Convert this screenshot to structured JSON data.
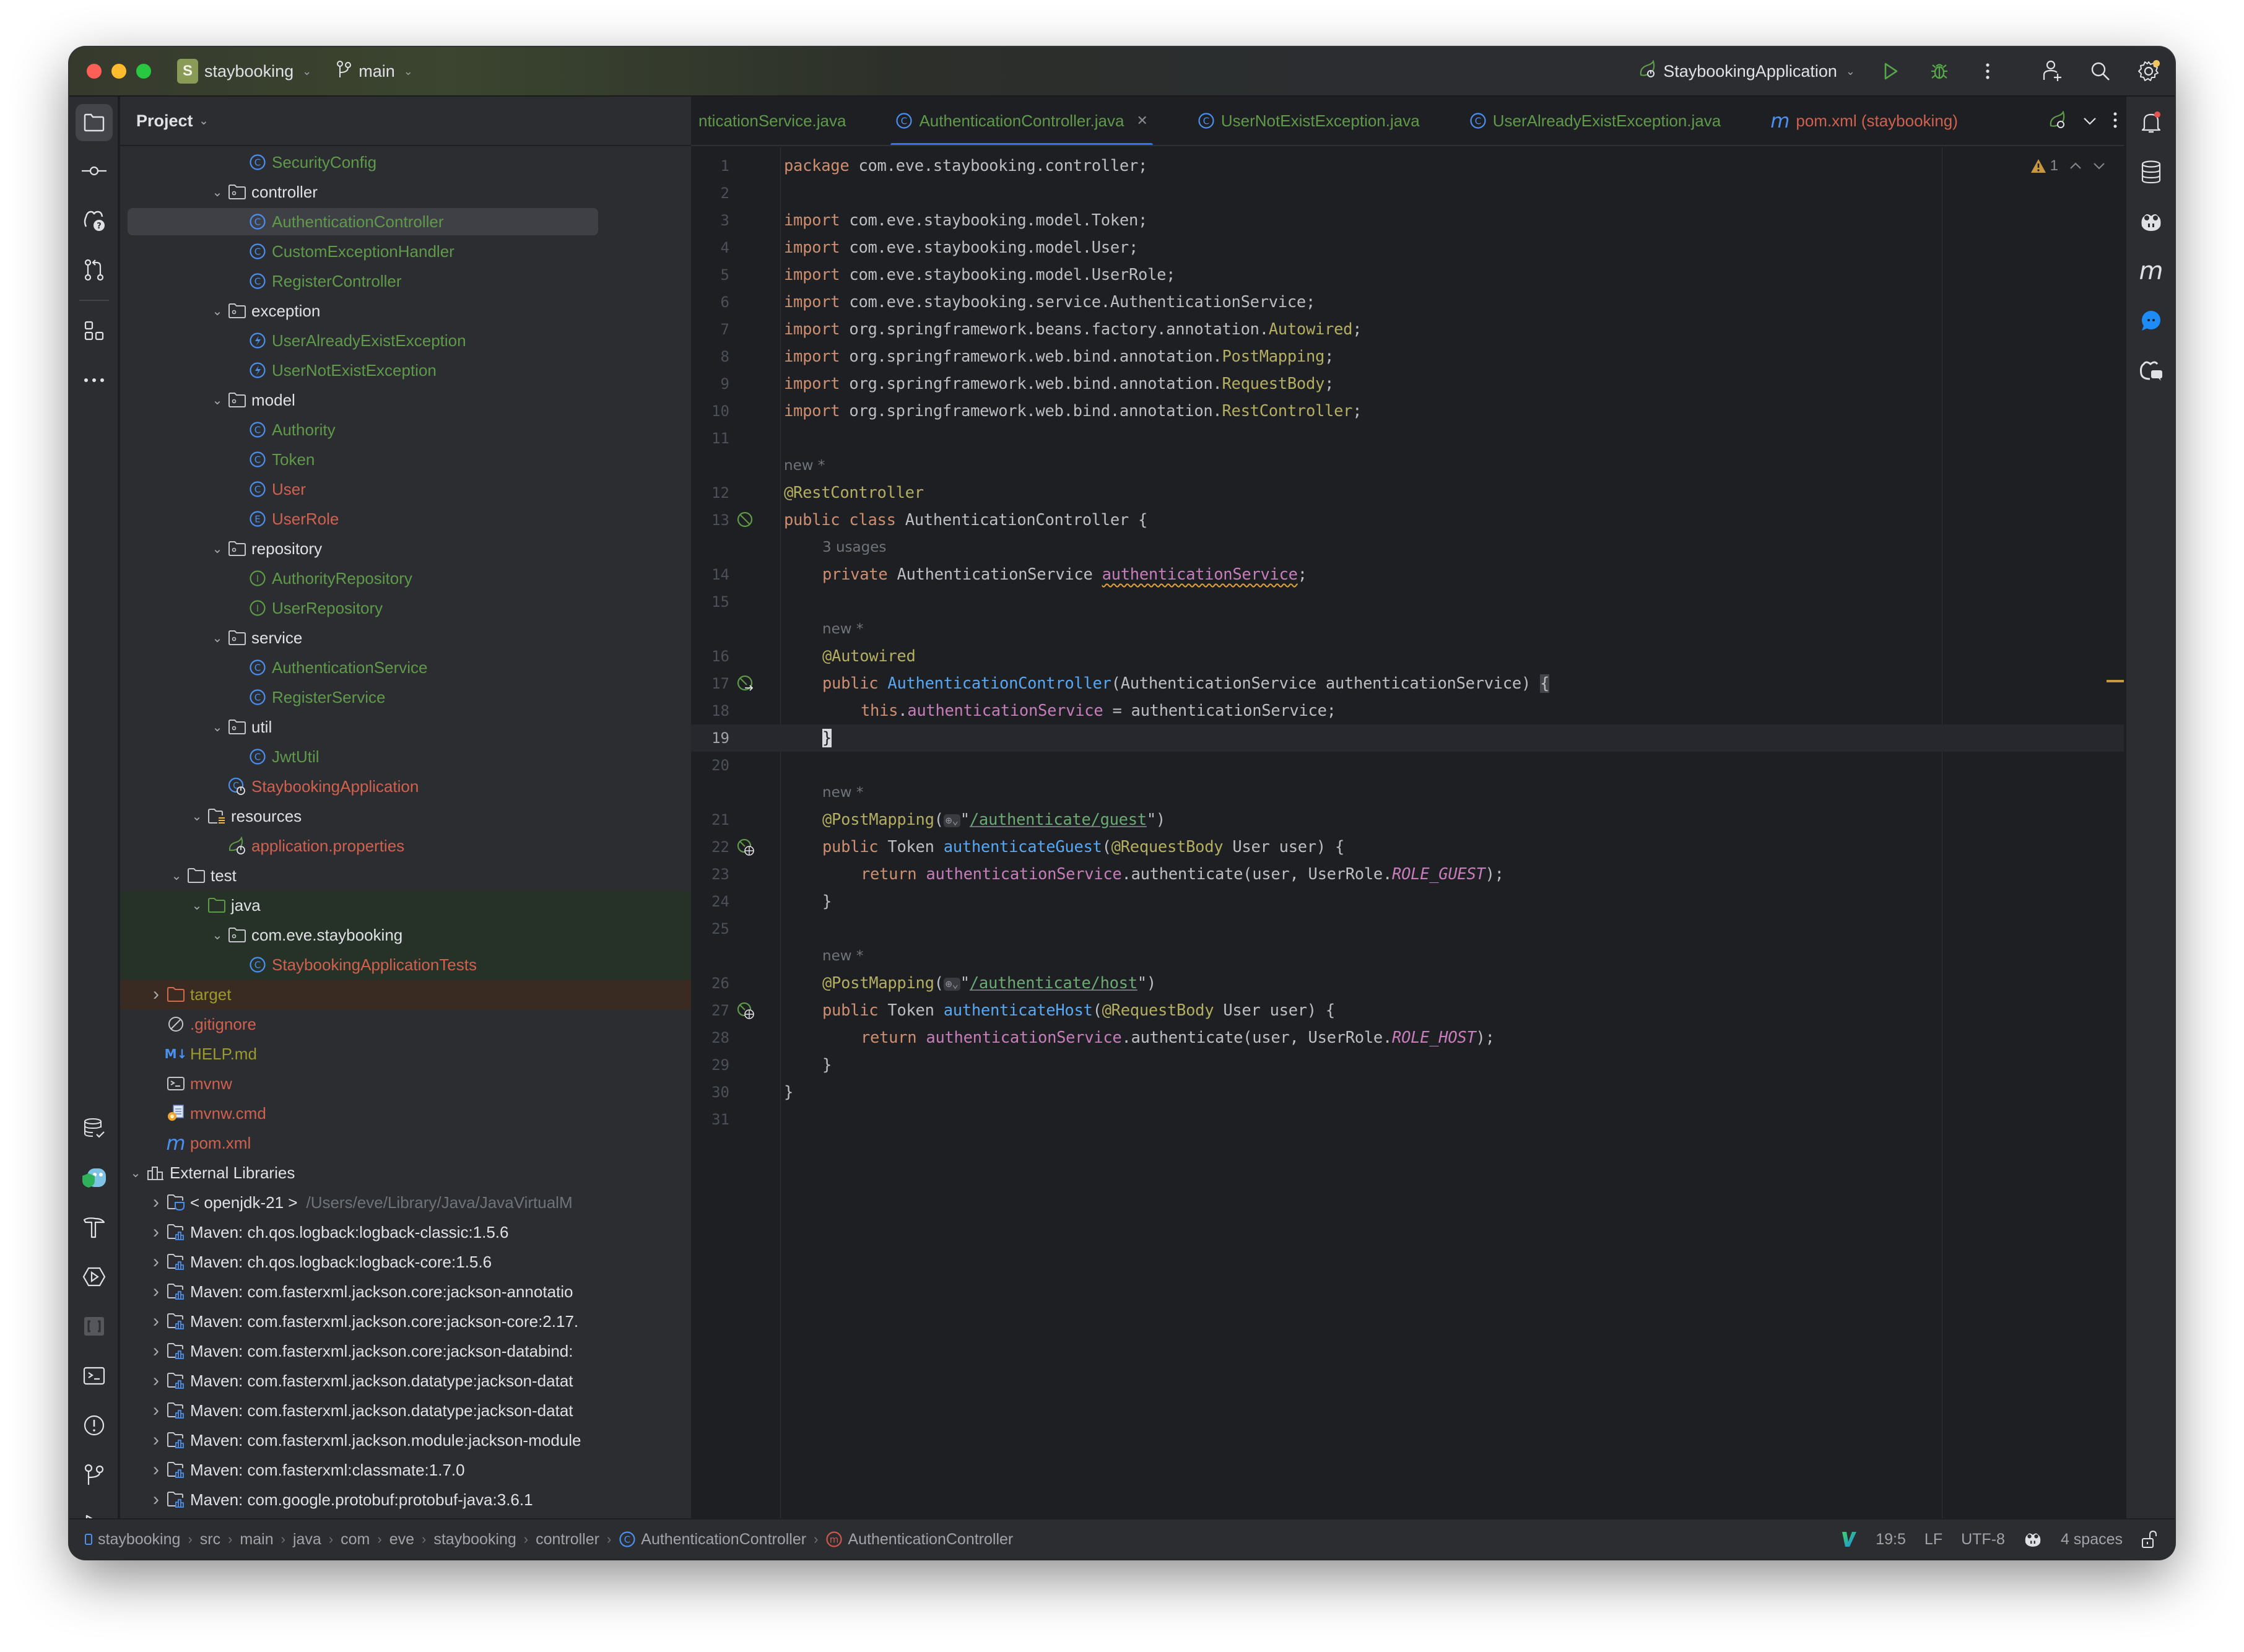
{
  "titlebar": {
    "project_badge": "S",
    "project_name": "staybooking",
    "branch": "main",
    "run_config": "StaybookingApplication"
  },
  "colors": {
    "accent": "#3574f0",
    "vcs_added": "#5f9a4a",
    "vcs_modified_unversioned": "#d0614f",
    "ignored": "#9c9a2b",
    "warning": "#e0a33b"
  },
  "project_panel": {
    "title": "Project",
    "tree": [
      {
        "label": "SecurityConfig",
        "icon": "class-icon",
        "depth": 4,
        "color": "green"
      },
      {
        "label": "controller",
        "icon": "package-icon",
        "depth": 3,
        "color": "white",
        "expanded": true
      },
      {
        "label": "AuthenticationController",
        "icon": "class-icon",
        "depth": 4,
        "color": "green",
        "selected": true
      },
      {
        "label": "CustomExceptionHandler",
        "icon": "class-icon",
        "depth": 4,
        "color": "green"
      },
      {
        "label": "RegisterController",
        "icon": "class-icon",
        "depth": 4,
        "color": "green"
      },
      {
        "label": "exception",
        "icon": "package-icon",
        "depth": 3,
        "color": "white",
        "expanded": true
      },
      {
        "label": "UserAlreadyExistException",
        "icon": "exception-icon",
        "depth": 4,
        "color": "green"
      },
      {
        "label": "UserNotExistException",
        "icon": "exception-icon",
        "depth": 4,
        "color": "green"
      },
      {
        "label": "model",
        "icon": "package-icon",
        "depth": 3,
        "color": "white",
        "expanded": true
      },
      {
        "label": "Authority",
        "icon": "class-icon",
        "depth": 4,
        "color": "green"
      },
      {
        "label": "Token",
        "icon": "class-icon",
        "depth": 4,
        "color": "green"
      },
      {
        "label": "User",
        "icon": "class-icon",
        "depth": 4,
        "color": "red"
      },
      {
        "label": "UserRole",
        "icon": "enum-icon",
        "depth": 4,
        "color": "red"
      },
      {
        "label": "repository",
        "icon": "package-icon",
        "depth": 3,
        "color": "white",
        "expanded": true
      },
      {
        "label": "AuthorityRepository",
        "icon": "interface-icon",
        "depth": 4,
        "color": "green"
      },
      {
        "label": "UserRepository",
        "icon": "interface-icon",
        "depth": 4,
        "color": "green"
      },
      {
        "label": "service",
        "icon": "package-icon",
        "depth": 3,
        "color": "white",
        "expanded": true
      },
      {
        "label": "AuthenticationService",
        "icon": "class-icon",
        "depth": 4,
        "color": "green"
      },
      {
        "label": "RegisterService",
        "icon": "class-icon",
        "depth": 4,
        "color": "green"
      },
      {
        "label": "util",
        "icon": "package-icon",
        "depth": 3,
        "color": "white",
        "expanded": true
      },
      {
        "label": "JwtUtil",
        "icon": "class-icon",
        "depth": 4,
        "color": "green"
      },
      {
        "label": "StaybookingApplication",
        "icon": "spring-boot-class-icon",
        "depth": 3,
        "color": "red"
      },
      {
        "label": "resources",
        "icon": "resources-folder-icon",
        "depth": 2,
        "color": "white",
        "expanded": true
      },
      {
        "label": "application.properties",
        "icon": "spring-properties-icon",
        "depth": 3,
        "color": "red"
      },
      {
        "label": "test",
        "icon": "folder-icon",
        "depth": 1,
        "color": "white",
        "expanded": true
      },
      {
        "label": "java",
        "icon": "test-folder-icon",
        "depth": 2,
        "color": "white",
        "expanded": true,
        "bg": "test"
      },
      {
        "label": "com.eve.staybooking",
        "icon": "package-icon",
        "depth": 3,
        "color": "white",
        "expanded": true,
        "bg": "test"
      },
      {
        "label": "StaybookingApplicationTests",
        "icon": "class-icon",
        "depth": 4,
        "color": "red",
        "bg": "test"
      },
      {
        "label": "target",
        "icon": "excluded-folder-icon",
        "depth": 0,
        "color": "olive",
        "expanded": false,
        "bg": "excluded"
      },
      {
        "label": ".gitignore",
        "icon": "ignore-file-icon",
        "depth": 0,
        "color": "red",
        "leaf": true
      },
      {
        "label": "HELP.md",
        "icon": "markdown-icon",
        "depth": 0,
        "color": "olive",
        "leaf": true
      },
      {
        "label": "mvnw",
        "icon": "shell-script-icon",
        "depth": 0,
        "color": "red",
        "leaf": true
      },
      {
        "label": "mvnw.cmd",
        "icon": "cmd-script-icon",
        "depth": 0,
        "color": "red",
        "leaf": true
      },
      {
        "label": "pom.xml",
        "icon": "maven-icon",
        "depth": 0,
        "color": "red",
        "leaf": true
      },
      {
        "label": "External Libraries",
        "icon": "libraries-icon",
        "depth": -1,
        "color": "white",
        "expanded": true
      },
      {
        "label": "< openjdk-21 >",
        "suffix": "/Users/eve/Library/Java/JavaVirtualM",
        "icon": "jdk-icon",
        "depth": 0,
        "color": "white",
        "expanded": false
      },
      {
        "label": "Maven: ch.qos.logback:logback-classic:1.5.6",
        "icon": "library-icon",
        "depth": 0,
        "color": "white",
        "expanded": false
      },
      {
        "label": "Maven: ch.qos.logback:logback-core:1.5.6",
        "icon": "library-icon",
        "depth": 0,
        "color": "white",
        "expanded": false
      },
      {
        "label": "Maven: com.fasterxml.jackson.core:jackson-annotatio",
        "icon": "library-icon",
        "depth": 0,
        "color": "white",
        "expanded": false
      },
      {
        "label": "Maven: com.fasterxml.jackson.core:jackson-core:2.17.",
        "icon": "library-icon",
        "depth": 0,
        "color": "white",
        "expanded": false
      },
      {
        "label": "Maven: com.fasterxml.jackson.core:jackson-databind:",
        "icon": "library-icon",
        "depth": 0,
        "color": "white",
        "expanded": false
      },
      {
        "label": "Maven: com.fasterxml.jackson.datatype:jackson-datat",
        "icon": "library-icon",
        "depth": 0,
        "color": "white",
        "expanded": false
      },
      {
        "label": "Maven: com.fasterxml.jackson.datatype:jackson-datat",
        "icon": "library-icon",
        "depth": 0,
        "color": "white",
        "expanded": false
      },
      {
        "label": "Maven: com.fasterxml.jackson.module:jackson-module",
        "icon": "library-icon",
        "depth": 0,
        "color": "white",
        "expanded": false
      },
      {
        "label": "Maven: com.fasterxml:classmate:1.7.0",
        "icon": "library-icon",
        "depth": 0,
        "color": "white",
        "expanded": false
      },
      {
        "label": "Maven: com.google.protobuf:protobuf-java:3.6.1",
        "icon": "library-icon",
        "depth": 0,
        "color": "white",
        "expanded": false
      }
    ]
  },
  "editor": {
    "tabs": [
      {
        "label": "nticationService.java",
        "icon": "none",
        "color": "green"
      },
      {
        "label": "AuthenticationController.java",
        "icon": "class-icon",
        "color": "green",
        "active": true,
        "closable": true
      },
      {
        "label": "UserNotExistException.java",
        "icon": "class-icon",
        "color": "green"
      },
      {
        "label": "UserAlreadyExistException.java",
        "icon": "class-icon",
        "color": "green"
      },
      {
        "label": "pom.xml (staybooking)",
        "icon": "maven-icon",
        "color": "red"
      }
    ],
    "problems": {
      "warnings": "1"
    },
    "inlay_new": "new *",
    "inlay_usages": "3 usages",
    "lines": [
      {
        "n": "1",
        "tokens": [
          [
            "kw",
            "package"
          ],
          [
            "",
            "com.eve.staybooking.controller;"
          ]
        ]
      },
      {
        "n": "2",
        "tokens": []
      },
      {
        "n": "3",
        "tokens": [
          [
            "kw",
            "import"
          ],
          [
            "",
            "com.eve.staybooking.model.Token;"
          ]
        ]
      },
      {
        "n": "4",
        "tokens": [
          [
            "kw",
            "import"
          ],
          [
            "",
            "com.eve.staybooking.model.User;"
          ]
        ]
      },
      {
        "n": "5",
        "tokens": [
          [
            "kw",
            "import"
          ],
          [
            "",
            "com.eve.staybooking.model.UserRole;"
          ]
        ]
      },
      {
        "n": "6",
        "tokens": [
          [
            "kw",
            "import"
          ],
          [
            "",
            "com.eve.staybooking.service.AuthenticationService;"
          ]
        ]
      },
      {
        "n": "7",
        "tokens": [
          [
            "kw",
            "import"
          ],
          [
            "",
            "org.springframework.beans.factory.annotation."
          ],
          [
            "ann",
            "Autowired"
          ],
          [
            "",
            ";"
          ]
        ]
      },
      {
        "n": "8",
        "tokens": [
          [
            "kw",
            "import"
          ],
          [
            "",
            "org.springframework.web.bind.annotation."
          ],
          [
            "ann",
            "PostMapping"
          ],
          [
            "",
            ";"
          ]
        ]
      },
      {
        "n": "9",
        "tokens": [
          [
            "kw",
            "import"
          ],
          [
            "",
            "org.springframework.web.bind.annotation."
          ],
          [
            "ann",
            "RequestBody"
          ],
          [
            "",
            ";"
          ]
        ]
      },
      {
        "n": "10",
        "tokens": [
          [
            "kw",
            "import"
          ],
          [
            "",
            "org.springframework.web.bind.annotation."
          ],
          [
            "ann",
            "RestController"
          ],
          [
            "",
            ";"
          ]
        ]
      },
      {
        "n": "11",
        "tokens": []
      },
      {
        "inlay": "new *",
        "indent": 0
      },
      {
        "n": "12",
        "tokens": [
          [
            "ann",
            "@RestController"
          ]
        ]
      },
      {
        "n": "13",
        "gutter": "spring-bean-icon",
        "tokens": [
          [
            "kw",
            "public class"
          ],
          [
            "",
            "AuthenticationController {"
          ]
        ]
      },
      {
        "inlay": "3 usages",
        "indent": 1
      },
      {
        "n": "14",
        "indent": 1,
        "tokens": [
          [
            "kw",
            "private"
          ],
          [
            "",
            "AuthenticationService"
          ],
          [
            "fld warn-uline",
            "authenticationService"
          ],
          [
            "",
            ";"
          ]
        ]
      },
      {
        "n": "15",
        "tokens": []
      },
      {
        "inlay": "new *",
        "indent": 1
      },
      {
        "n": "16",
        "indent": 1,
        "tokens": [
          [
            "ann",
            "@Autowired"
          ]
        ]
      },
      {
        "n": "17",
        "gutter": "spring-autowire-icon",
        "indent": 1,
        "tokens": [
          [
            "kw",
            "public"
          ],
          [
            "fn",
            "AuthenticationController"
          ],
          [
            "",
            "(AuthenticationService authenticationService) "
          ],
          [
            "match-brace",
            "{"
          ]
        ]
      },
      {
        "n": "18",
        "indent": 2,
        "tokens": [
          [
            "kw",
            "this"
          ],
          [
            "",
            "."
          ],
          [
            "fld",
            "authenticationService"
          ],
          [
            "",
            " = authenticationService;"
          ]
        ]
      },
      {
        "n": "19",
        "current": true,
        "indent": 1,
        "tokens": [
          [
            "caret-brace",
            "}"
          ]
        ]
      },
      {
        "n": "20",
        "tokens": []
      },
      {
        "inlay": "new *",
        "indent": 1
      },
      {
        "n": "21",
        "indent": 1,
        "tokens": [
          [
            "ann",
            "@PostMapping"
          ],
          [
            "",
            "("
          ],
          [
            "chip",
            "⊕⌄"
          ],
          [
            "",
            "\""
          ],
          [
            "str",
            "/authenticate/guest"
          ],
          [
            "",
            "\")"
          ]
        ]
      },
      {
        "n": "22",
        "gutter": "endpoint-icon",
        "indent": 1,
        "tokens": [
          [
            "kw",
            "public"
          ],
          [
            "",
            "Token"
          ],
          [
            "fn",
            "authenticateGuest"
          ],
          [
            "",
            "("
          ],
          [
            "ann",
            "@RequestBody"
          ],
          [
            "",
            "User user) {"
          ]
        ]
      },
      {
        "n": "23",
        "indent": 2,
        "tokens": [
          [
            "kw",
            "return"
          ],
          [
            "fld",
            "authenticationService"
          ],
          [
            "",
            ".authenticate(user, UserRole."
          ],
          [
            "const",
            "ROLE_GUEST"
          ],
          [
            "",
            ");"
          ]
        ]
      },
      {
        "n": "24",
        "indent": 1,
        "tokens": [
          [
            "",
            "}"
          ]
        ]
      },
      {
        "n": "25",
        "tokens": []
      },
      {
        "inlay": "new *",
        "indent": 1
      },
      {
        "n": "26",
        "indent": 1,
        "tokens": [
          [
            "ann",
            "@PostMapping"
          ],
          [
            "",
            "("
          ],
          [
            "chip",
            "⊕⌄"
          ],
          [
            "",
            "\""
          ],
          [
            "str",
            "/authenticate/host"
          ],
          [
            "",
            "\")"
          ]
        ]
      },
      {
        "n": "27",
        "gutter": "endpoint-icon",
        "indent": 1,
        "tokens": [
          [
            "kw",
            "public"
          ],
          [
            "",
            "Token"
          ],
          [
            "fn",
            "authenticateHost"
          ],
          [
            "",
            "("
          ],
          [
            "ann",
            "@RequestBody"
          ],
          [
            "",
            "User user) {"
          ]
        ]
      },
      {
        "n": "28",
        "indent": 2,
        "tokens": [
          [
            "kw",
            "return"
          ],
          [
            "fld",
            "authenticationService"
          ],
          [
            "",
            ".authenticate(user, UserRole."
          ],
          [
            "const",
            "ROLE_HOST"
          ],
          [
            "",
            ");"
          ]
        ]
      },
      {
        "n": "29",
        "indent": 1,
        "tokens": [
          [
            "",
            "}"
          ]
        ]
      },
      {
        "n": "30",
        "tokens": [
          [
            "",
            "}"
          ]
        ]
      },
      {
        "n": "31",
        "tokens": []
      }
    ]
  },
  "statusbar": {
    "breadcrumbs": [
      "staybooking",
      "src",
      "main",
      "java",
      "com",
      "eve",
      "staybooking",
      "controller",
      "AuthenticationController",
      "AuthenticationController"
    ],
    "caret_position": "19:5",
    "line_separator": "LF",
    "encoding": "UTF-8",
    "indent": "4 spaces"
  }
}
